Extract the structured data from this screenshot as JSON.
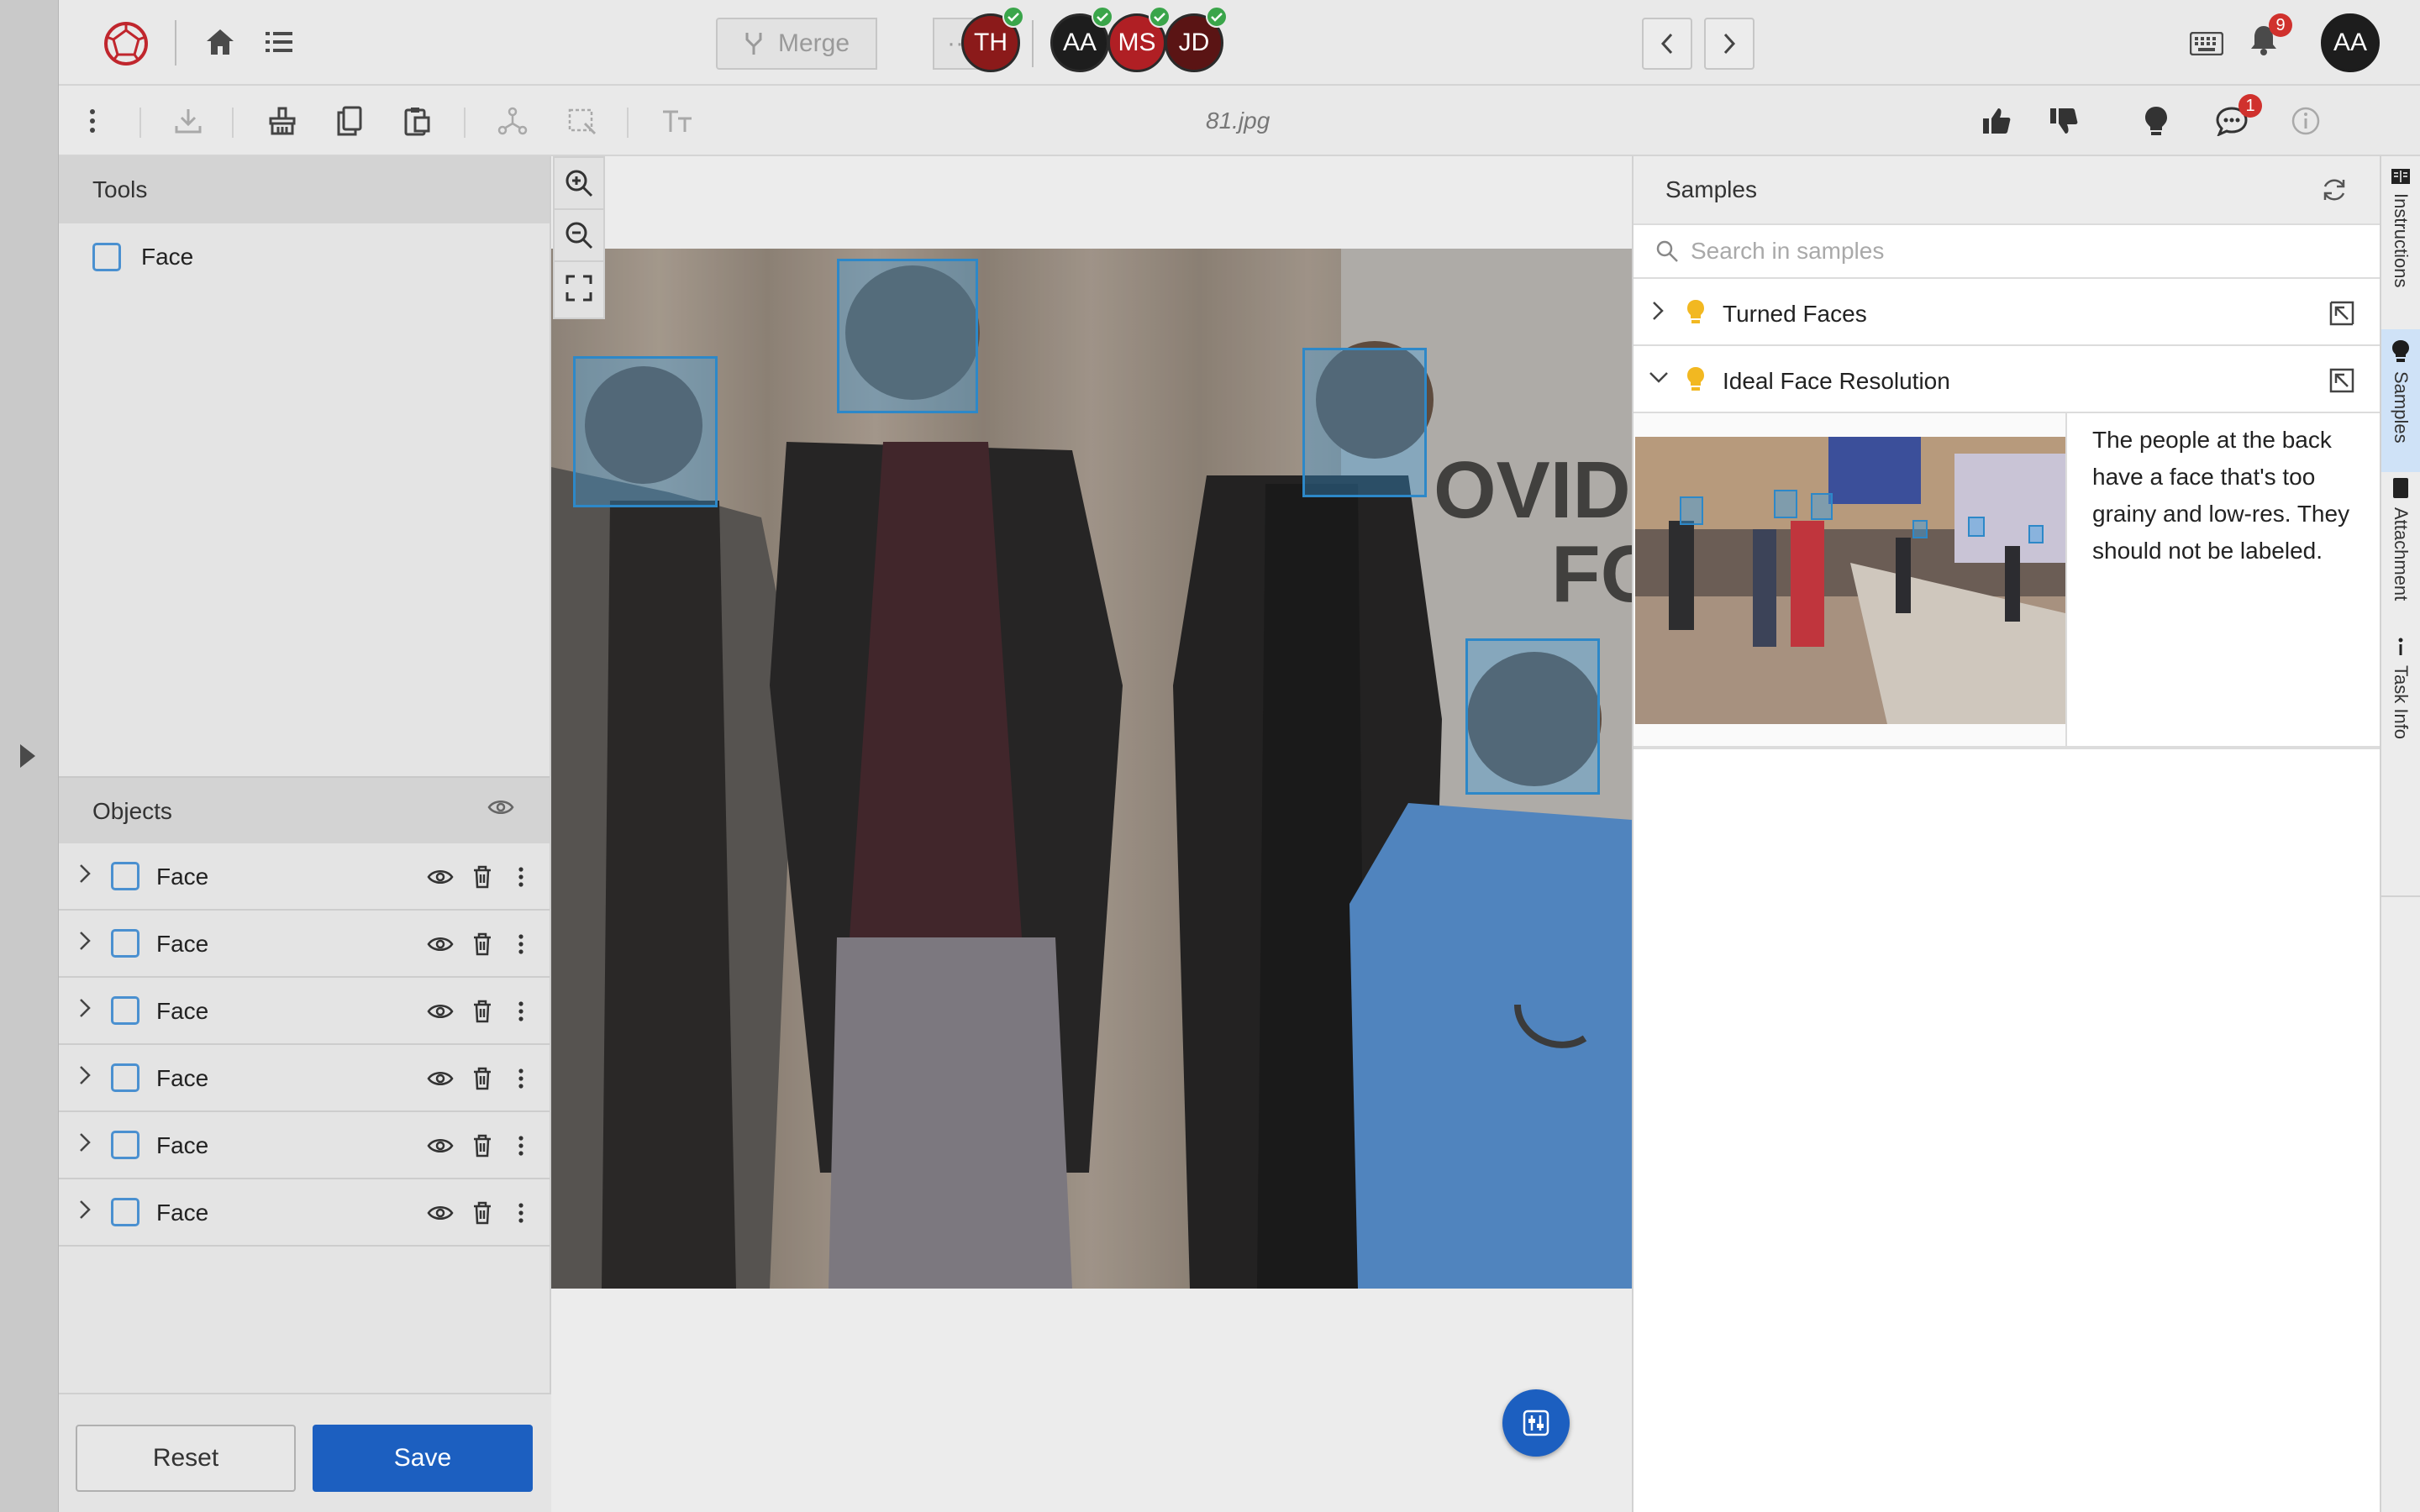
{
  "toolbar": {
    "merge_label": "Merge",
    "merge_more": "···",
    "filename": "81.jpg",
    "comments_badge": "1"
  },
  "collaborators": [
    {
      "initials": "TH",
      "color": "#8b1a1a"
    },
    {
      "initials": "AA",
      "color": "#1d1d1d"
    },
    {
      "initials": "MS",
      "color": "#b01f24"
    },
    {
      "initials": "JD",
      "color": "#5a1414"
    }
  ],
  "header": {
    "notifications_badge": "9",
    "user_initials": "AA"
  },
  "tools": {
    "title": "Tools",
    "items": [
      {
        "label": "Face"
      }
    ]
  },
  "objects": {
    "title": "Objects",
    "items": [
      {
        "label": "Face"
      },
      {
        "label": "Face"
      },
      {
        "label": "Face"
      },
      {
        "label": "Face"
      },
      {
        "label": "Face"
      },
      {
        "label": "Face"
      }
    ]
  },
  "footer": {
    "reset_label": "Reset",
    "save_label": "Save"
  },
  "image": {
    "banner_text_line1": "OVID",
    "banner_text_line2": "FC"
  },
  "samples": {
    "title": "Samples",
    "search_placeholder": "Search in samples",
    "items": [
      {
        "label": "Turned Faces",
        "expanded": false
      },
      {
        "label": "Ideal Face Resolution",
        "expanded": true,
        "description": "The people at the back have a face that's too grainy and low-res. They should not be labeled."
      }
    ]
  },
  "side_tabs": [
    {
      "label": "Instructions"
    },
    {
      "label": "Samples"
    },
    {
      "label": "Attachment"
    },
    {
      "label": "Task Info"
    }
  ],
  "colors": {
    "accent": "#1c5fc0",
    "box": "#2d88c8",
    "bulb": "#f2b821",
    "badge": "#d0312d"
  }
}
